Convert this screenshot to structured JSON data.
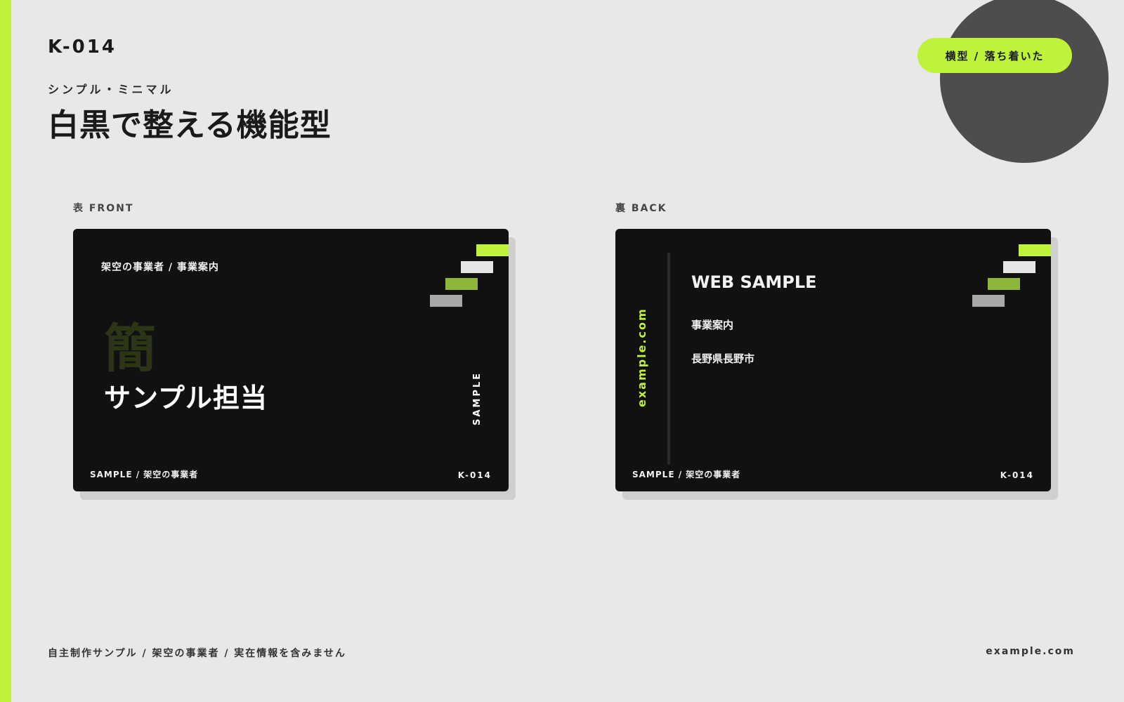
{
  "header": {
    "code": "K-014",
    "subtitle": "シンプル・ミニマル",
    "title": "白黒で整える機能型",
    "tag": "横型 / 落ち着いた"
  },
  "front": {
    "label": "表 FRONT",
    "top_text": "架空の事業者 / 事業案内",
    "kanji": "簡",
    "name": "サンプル担当",
    "vertical_text": "SAMPLE",
    "footer_left": "SAMPLE / 架空の事業者",
    "footer_right": "K-014"
  },
  "back": {
    "label": "裏 BACK",
    "vertical_text": "example.com",
    "heading": "WEB SAMPLE",
    "line1": "事業案内",
    "line2": "長野県長野市",
    "footer_left": "SAMPLE / 架空の事業者",
    "footer_right": "K-014"
  },
  "footer": {
    "left": "自主制作サンプル / 架空の事業者 / 実在情報を含みません",
    "right": "example.com"
  },
  "colors": {
    "accent": "#bff23a",
    "card": "#111111",
    "background": "#e8e8e6",
    "circle": "#4d4d4d"
  }
}
